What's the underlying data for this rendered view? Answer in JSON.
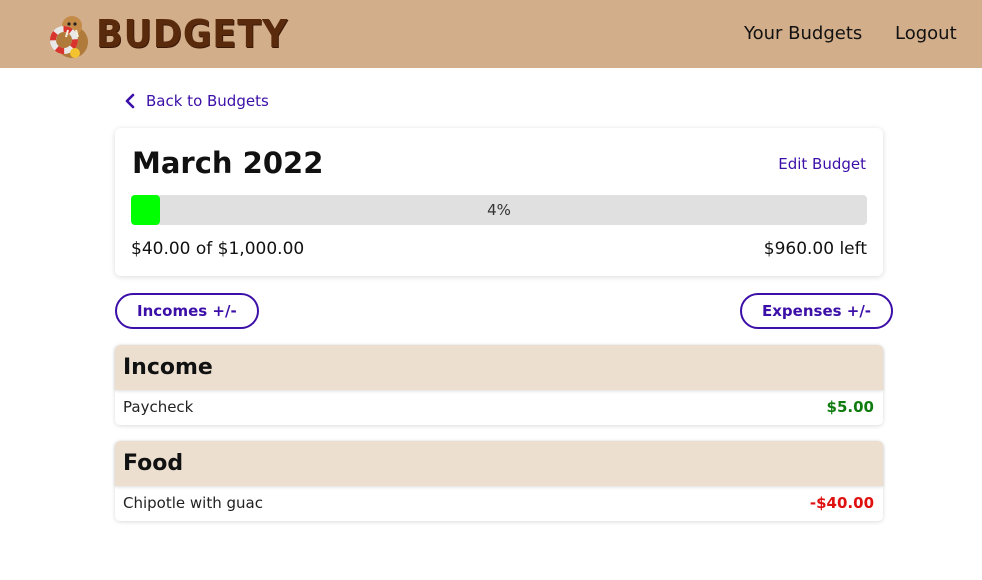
{
  "header": {
    "logo_text": "BUDGETY",
    "nav_budgets": "Your Budgets",
    "nav_logout": "Logout",
    "bg_color": "#d2ae8a"
  },
  "back_link": {
    "label": "Back to Budgets",
    "icon": "chevron-left-icon"
  },
  "budget": {
    "title": "March 2022",
    "edit_label": "Edit Budget",
    "progress_percent": 4,
    "progress_label": "4%",
    "spent_text": "$40.00 of $1,000.00",
    "left_text": "$960.00 left",
    "progress_color": "#00ff00"
  },
  "actions": {
    "incomes_label": "Incomes +/-",
    "expenses_label": "Expenses +/-",
    "accent": "#3c0fa8"
  },
  "categories": [
    {
      "name": "Income",
      "items": [
        {
          "name": "Paycheck",
          "amount": "$5.00",
          "type": "income"
        }
      ]
    },
    {
      "name": "Food",
      "items": [
        {
          "name": "Chipotle with guac",
          "amount": "-$40.00",
          "type": "expense"
        }
      ]
    }
  ]
}
